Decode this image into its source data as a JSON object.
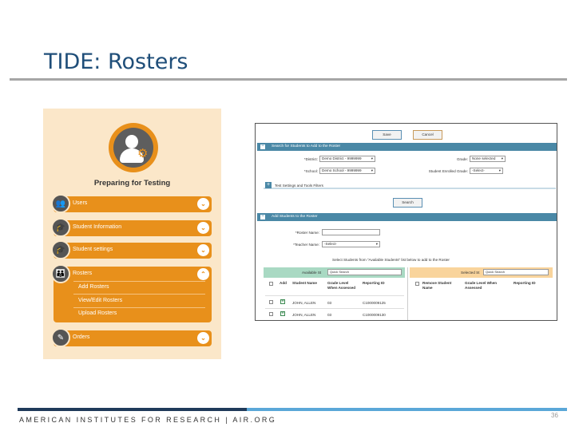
{
  "slide": {
    "title": "TIDE: Rosters",
    "footer": "AMERICAN INSTITUTES FOR RESEARCH | AIR.ORG",
    "page_number": "36"
  },
  "menu": {
    "heading": "Preparing for Testing",
    "items": [
      {
        "label": "Users",
        "icon": "users-icon"
      },
      {
        "label": "Student Information",
        "icon": "graduation-cap-icon"
      },
      {
        "label": "Student settings",
        "icon": "graduation-cap-icon"
      },
      {
        "label": "Rosters",
        "icon": "roster-icon"
      },
      {
        "label": "Orders",
        "icon": "order-form-icon"
      }
    ],
    "roster_subitems": [
      "Add Rosters",
      "View/Edit Rosters",
      "Upload Rosters"
    ]
  },
  "screen": {
    "save_label": "Save",
    "cancel_label": "Cancel",
    "search_section_title": "Search for Students to Add to the Roster",
    "district_label": "*District:",
    "district_value": "Demo District - 9999999",
    "school_label": "*School:",
    "school_value": "Demo School - 9999999",
    "grade_label": "Grade:",
    "grade_value": "None selected",
    "enrolled_grade_label": "Student Enrolled Grade:",
    "enrolled_grade_value": "-Select-",
    "test_settings_label": "Test Settings and Tools Filters",
    "search_button": "Search",
    "add_section_title": "Add Students to the Roster",
    "roster_name_label": "*Roster Name:",
    "roster_name_value": "",
    "teacher_name_label": "*Teacher Name:",
    "teacher_name_value": "-Select-",
    "instruction": "Select Students from \"Available Students\" list below to add to the Roster",
    "available_title": "Available St",
    "available_search": "Quick Search",
    "selected_title": "Selected St",
    "selected_search": "Quick Search",
    "available_columns": [
      "Add",
      "Student Name",
      "Grade Level When Assessed",
      "Reporting ID"
    ],
    "selected_columns": [
      "Remove Student Name",
      "Grade Level When Assessed",
      "Reporting ID"
    ],
    "rows": [
      {
        "name": "JOHN, ALLEN",
        "grade": "03",
        "id": "C1000009125"
      },
      {
        "name": "JOHN, ALLEN",
        "grade": "03",
        "id": "C1000009130"
      }
    ]
  }
}
